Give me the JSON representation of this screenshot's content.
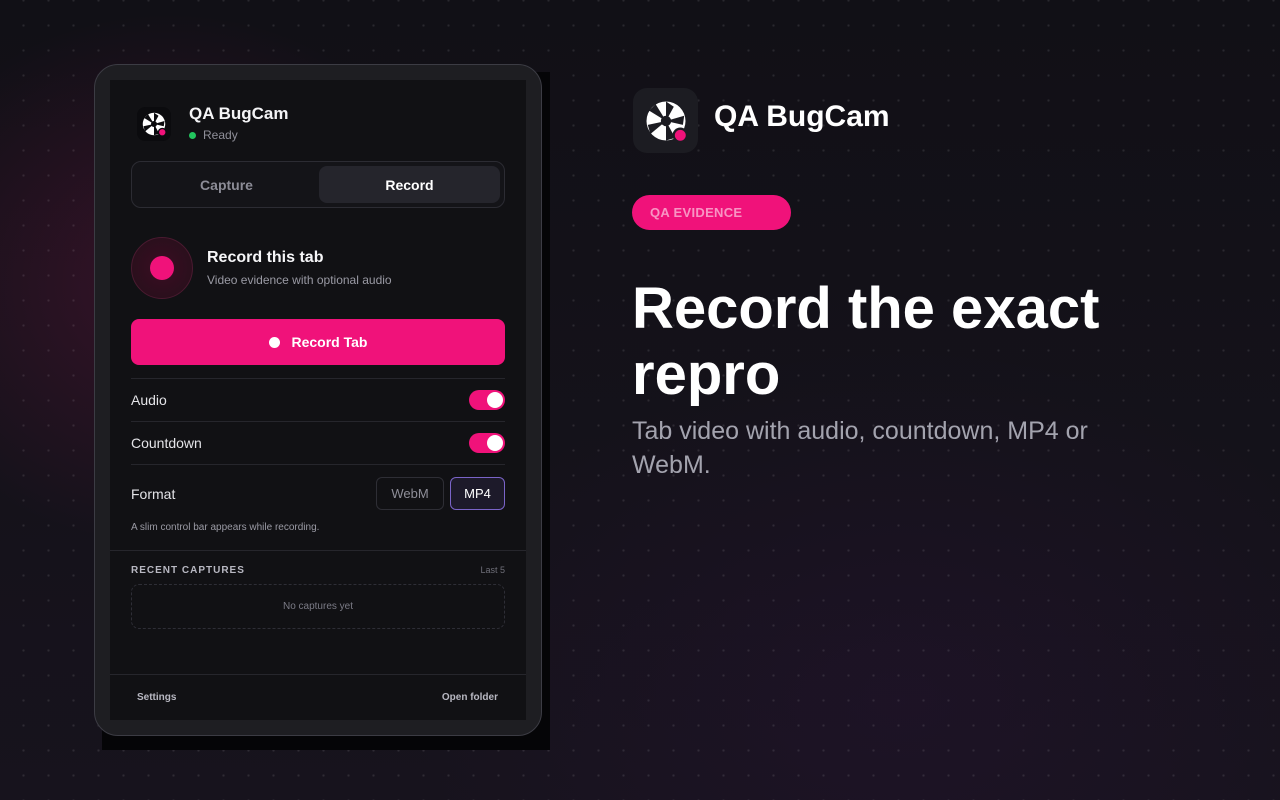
{
  "colors": {
    "accent": "#f0127a",
    "ready_dot": "#22c55e",
    "mp4_border": "#7a64c8"
  },
  "popup": {
    "app_name": "QA BugCam",
    "status": "Ready",
    "tabs": [
      {
        "label": "Capture",
        "selected": false
      },
      {
        "label": "Record",
        "selected": true
      }
    ],
    "record_card": {
      "title": "Record this tab",
      "subtitle": "Video evidence with optional audio"
    },
    "record_button": "Record Tab",
    "options": {
      "audio": {
        "label": "Audio",
        "enabled": true
      },
      "countdown": {
        "label": "Countdown",
        "enabled": true
      },
      "format": {
        "label": "Format",
        "choices": [
          "WebM",
          "MP4"
        ],
        "selected": "MP4"
      }
    },
    "hint": "A slim control bar appears while recording.",
    "recent": {
      "title": "RECENT CAPTURES",
      "count_label": "Last 5",
      "empty": "No captures yet"
    },
    "footer": {
      "settings": "Settings",
      "open_folder": "Open folder"
    }
  },
  "hero": {
    "app_name": "QA BugCam",
    "badge": "QA EVIDENCE",
    "title": "Record the exact repro",
    "subtitle": "Tab video with audio, countdown, MP4 or WebM."
  }
}
